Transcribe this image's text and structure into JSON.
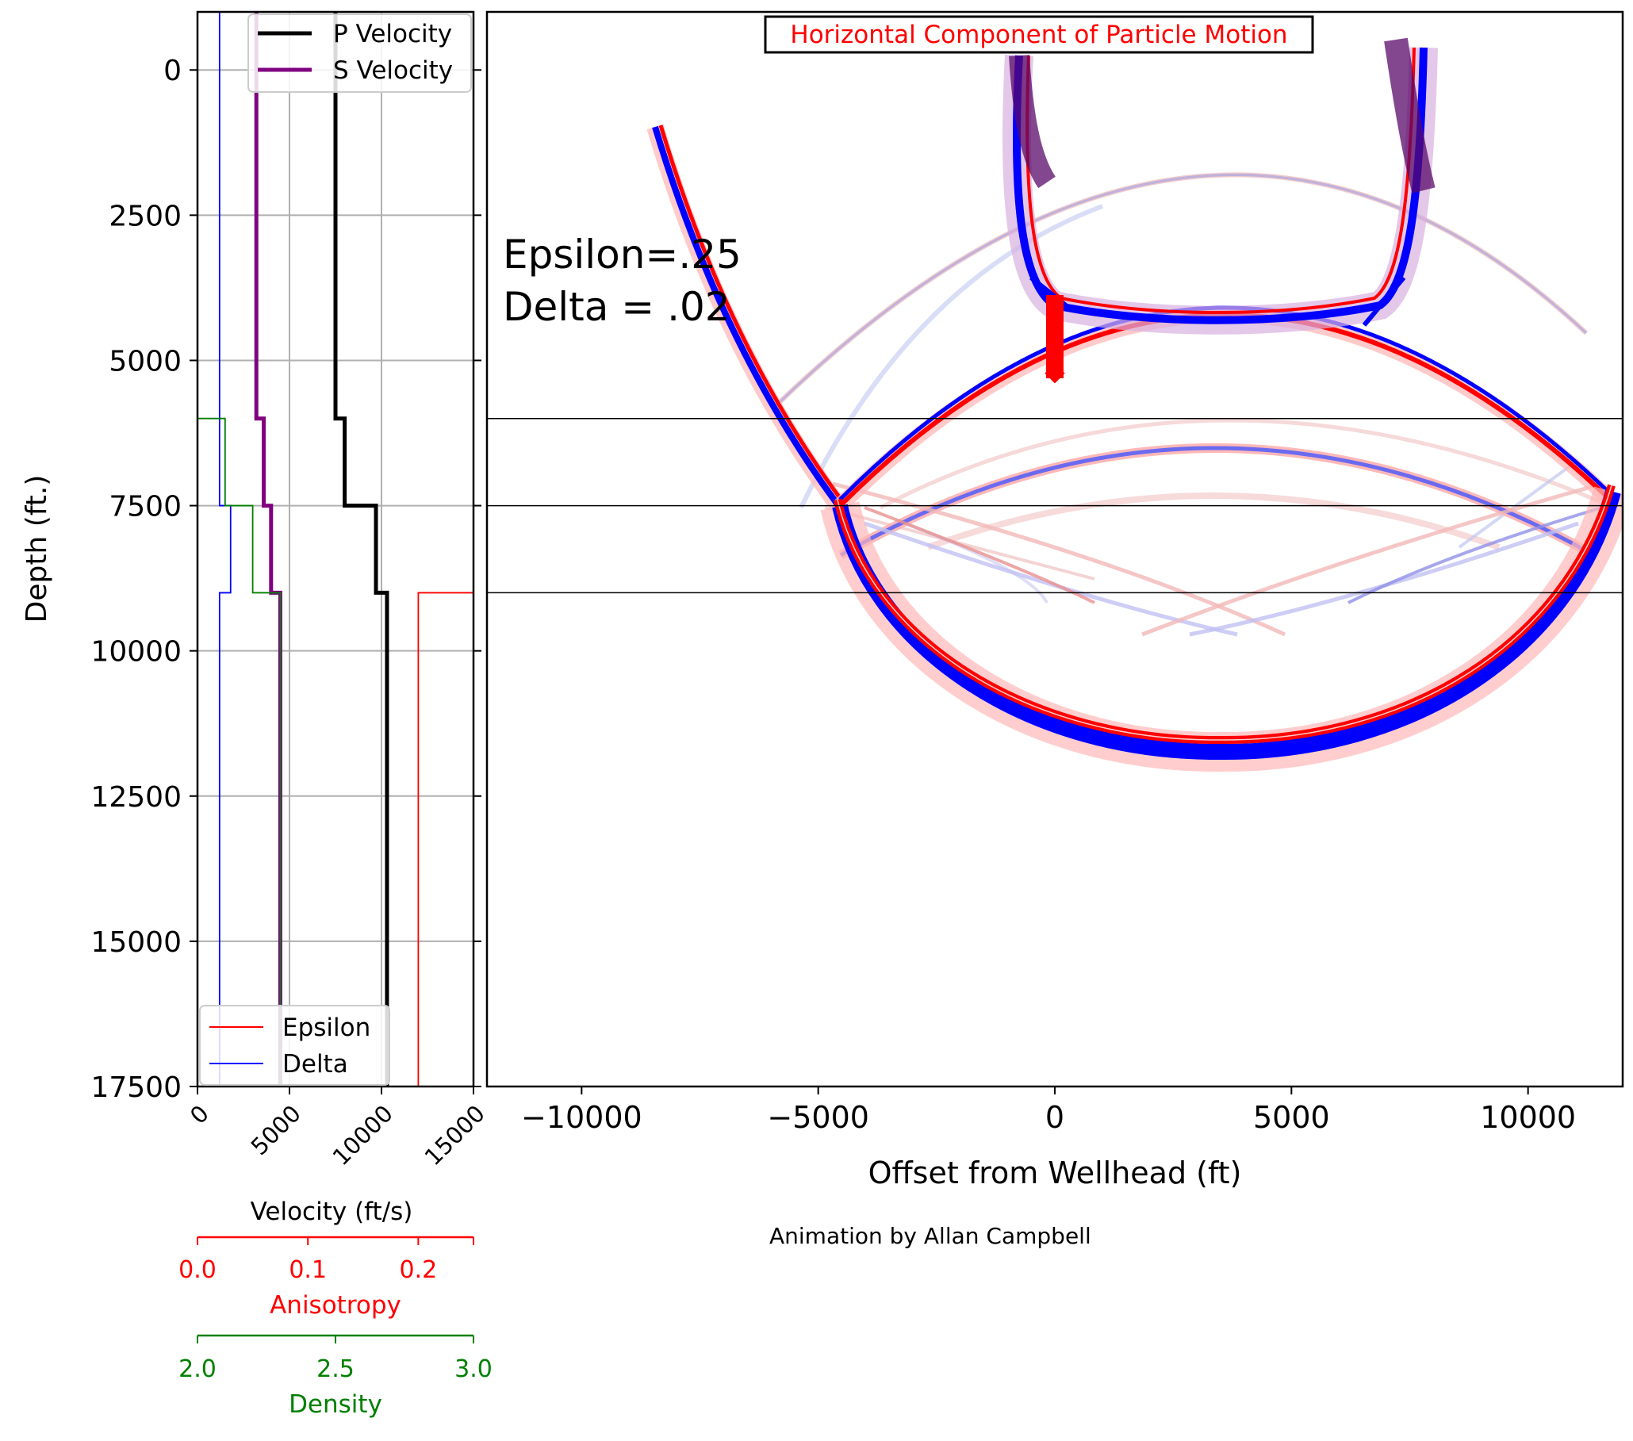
{
  "chart_data": [
    {
      "type": "line",
      "ylabel": "Depth (ft.)",
      "ylim": [
        17500,
        -1000
      ],
      "y_ticks": [
        0,
        2500,
        5000,
        7500,
        10000,
        12500,
        15000,
        17500
      ],
      "y_tick_labels": [
        "0",
        "2500",
        "5000",
        "7500",
        "10000",
        "12500",
        "15000",
        "17500"
      ],
      "grid": true,
      "velocity_axis": {
        "label": "Velocity (ft/s)",
        "range": [
          0,
          15000
        ],
        "ticks": [
          0,
          5000,
          10000,
          15000
        ],
        "tick_labels": [
          "0",
          "5000",
          "10000",
          "15000"
        ]
      },
      "anisotropy_axis": {
        "label": "Anisotropy",
        "range": [
          0,
          0.25
        ],
        "ticks": [
          0,
          0.1,
          0.2
        ],
        "tick_labels": [
          "0.0",
          "0.1",
          "0.2"
        ],
        "color": "#ff0000"
      },
      "density_axis": {
        "label": "Density",
        "range": [
          2.0,
          3.0
        ],
        "ticks": [
          2.0,
          2.5,
          3.0
        ],
        "tick_labels": [
          "2.0",
          "2.5",
          "3.0"
        ],
        "color": "#008000"
      },
      "legend_top": {
        "placement": "top-right",
        "entries": [
          {
            "label": "P Velocity",
            "color": "#000000"
          },
          {
            "label": "S Velocity",
            "color": "#800080"
          }
        ]
      },
      "legend_bottom": {
        "placement": "bottom-left",
        "entries": [
          {
            "label": "Epsilon",
            "color": "#ff0000"
          },
          {
            "label": "Delta",
            "color": "#0000ff"
          }
        ]
      },
      "series": [
        {
          "name": "P Velocity",
          "color": "#000000",
          "axis": "velocity",
          "x": [
            7500,
            7500,
            8000,
            8000,
            9700,
            9700,
            10300,
            10300
          ],
          "y": [
            -1000,
            6000,
            6000,
            7500,
            7500,
            9000,
            9000,
            17500
          ]
        },
        {
          "name": "S Velocity",
          "color": "#800080",
          "axis": "velocity",
          "x": [
            3200,
            3200,
            3600,
            3600,
            4000,
            4000,
            4500,
            4500
          ],
          "y": [
            -1000,
            6000,
            6000,
            7500,
            7500,
            9000,
            9000,
            17500
          ]
        },
        {
          "name": "Epsilon",
          "color": "#ff0000",
          "axis": "anisotropy",
          "x": [
            0.2,
            0.2,
            0.25
          ],
          "y": [
            17500,
            9000,
            9000
          ]
        },
        {
          "name": "Delta",
          "color": "#0000ff",
          "axis": "anisotropy",
          "x": [
            0.02,
            0.02,
            0.03,
            0.03,
            0.02,
            0.02
          ],
          "y": [
            -1000,
            7500,
            7500,
            9000,
            9000,
            17500
          ]
        },
        {
          "name": "",
          "color": "#008000",
          "axis": "density",
          "x": [
            2.0,
            2.1,
            2.1,
            2.2,
            2.2,
            2.3,
            2.3
          ],
          "y": [
            6000,
            6000,
            7500,
            7500,
            9000,
            9000,
            17500
          ]
        }
      ]
    },
    {
      "type": "heatmap",
      "title": "Horizontal Component of Particle Motion",
      "title_color": "#ff0000",
      "xlabel": "Offset from Wellhead (ft)",
      "xlim": [
        -12000,
        12000
      ],
      "ylim": [
        17500,
        -1000
      ],
      "x_ticks": [
        -10000,
        -5000,
        0,
        5000,
        10000
      ],
      "x_tick_labels": [
        "−10000",
        "−5000",
        "0",
        "5000",
        "10000"
      ],
      "layer_boundaries_depth": [
        6000,
        7500,
        9000
      ],
      "source": {
        "x": 0,
        "y_top": 3900,
        "y_bottom": 5300
      },
      "annotation": [
        "Epsilon=.25",
        "Delta = .02"
      ],
      "colormap": [
        "#0000ff",
        "#ffffff",
        "#ff0000"
      ]
    }
  ],
  "credit": "Animation by Allan Campbell"
}
